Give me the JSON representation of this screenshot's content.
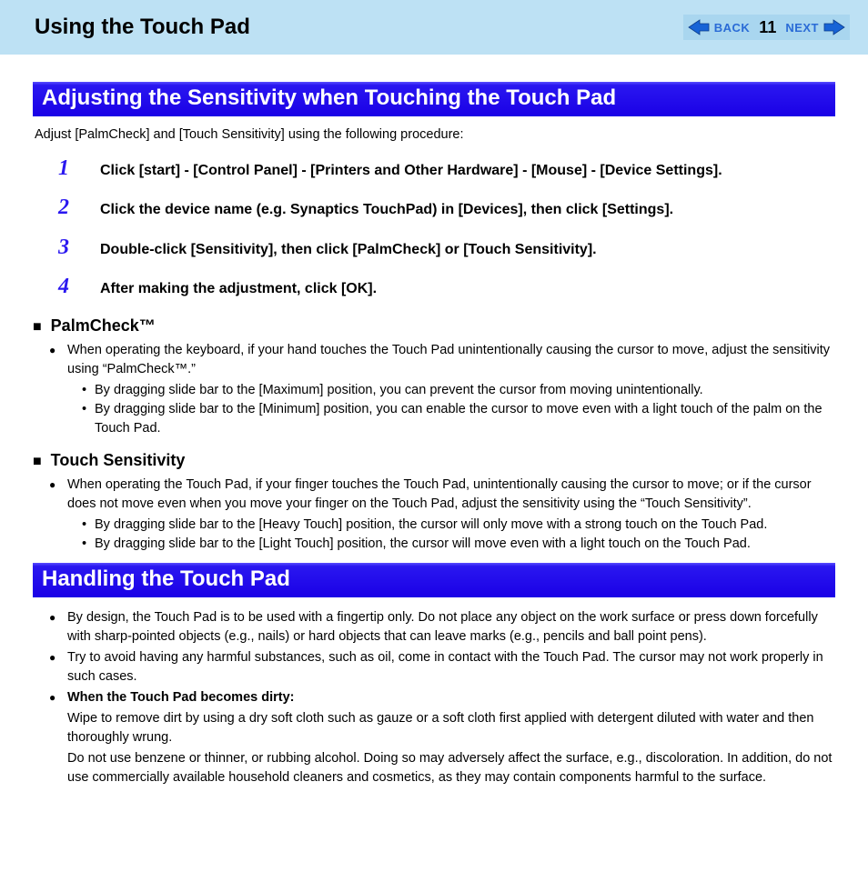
{
  "header": {
    "title": "Using the Touch Pad",
    "nav": {
      "back": "BACK",
      "page": "11",
      "next": "NEXT"
    }
  },
  "section1": {
    "title": "Adjusting the Sensitivity when Touching the Touch Pad",
    "intro": "Adjust [PalmCheck] and [Touch Sensitivity] using the following procedure:",
    "steps": [
      "Click [start] - [Control Panel] - [Printers and Other Hardware] - [Mouse] - [Device Settings].",
      "Click the device name (e.g. Synaptics TouchPad) in [Devices], then click [Settings].",
      "Double-click [Sensitivity], then click [PalmCheck] or [Touch Sensitivity].",
      "After making the adjustment, click [OK]."
    ],
    "palmcheck": {
      "title": "PalmCheck™",
      "bullet": "When operating the keyboard, if your hand touches the Touch Pad unintentionally causing the cursor to move, adjust the sensitivity using “PalmCheck™.”",
      "sub": [
        "By dragging slide bar to the [Maximum] position, you can prevent the cursor from moving unintentionally.",
        "By dragging slide bar to the [Minimum] position, you can enable the cursor to move even with a light touch of the palm on the Touch Pad."
      ]
    },
    "touchSensitivity": {
      "title": "Touch Sensitivity",
      "bullet": "When operating the Touch Pad, if your finger touches the Touch Pad, unintentionally causing the cursor to move; or if the cursor does not move even when you move your finger on the Touch Pad, adjust the sensitivity using the “Touch Sensitivity”.",
      "sub": [
        "By dragging slide bar to the [Heavy Touch] position, the cursor will only move with a strong touch on the Touch Pad.",
        "By dragging slide bar to the [Light Touch] position, the cursor will move even with a light touch on the Touch Pad."
      ]
    }
  },
  "section2": {
    "title": "Handling the Touch Pad",
    "bullets": [
      {
        "text": "By design, the Touch Pad is to be used with a fingertip only. Do not place any object on the work surface or press down forcefully with sharp-pointed objects (e.g., nails) or hard objects that can leave marks (e.g., pencils and ball point pens)."
      },
      {
        "text": "Try to avoid having any harmful substances, such as oil, come in contact with the Touch Pad. The cursor may not work properly in such cases."
      },
      {
        "boldLead": "When the Touch Pad becomes dirty:",
        "cont1": "Wipe to remove dirt by using a dry soft cloth such as gauze or a soft cloth first applied with detergent diluted with water and then thoroughly wrung.",
        "cont2": "Do not use benzene or thinner, or rubbing alcohol. Doing so may adversely affect the surface, e.g., discoloration.  In addition, do not use commercially available household cleaners and cosmetics, as they may contain components harmful to the surface."
      }
    ]
  }
}
